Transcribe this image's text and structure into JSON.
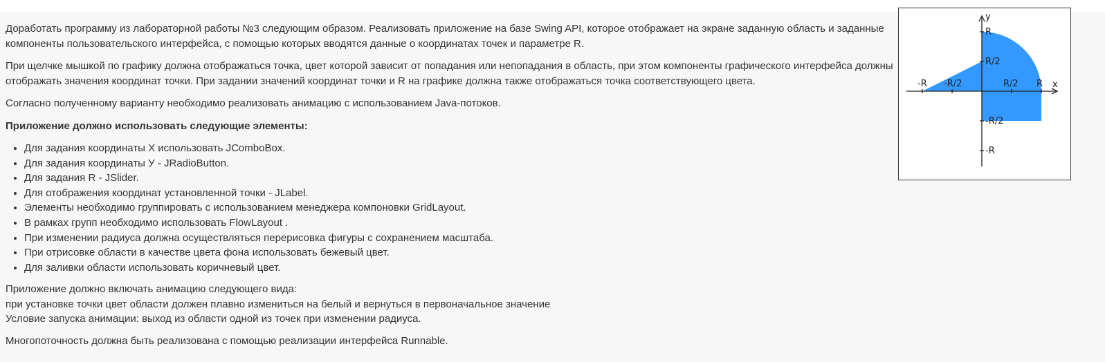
{
  "paragraphs": {
    "p1": "Доработать программу из лабораторной работы №3 следующим образом. Реализовать приложение на базе Swing API, которое отображает на экране заданную область и заданные компоненты пользовательского интерфейса, с помощью которых вводятся данные о координатах точек и параметре R.",
    "p2": "При щелчке мышкой по графику должна отображаться точка, цвет которой зависит от попадания или непопадания в область, при этом компоненты графического интерфейса должны отображать значения координат точки. При задании значений координат точки и R на графике должна также отображаться точка соответствующего цвета.",
    "p3": "Согласно полученному варианту необходимо реализовать анимацию с использованием Java-потоков.",
    "p4": "Приложение должно использовать следующие элементы:"
  },
  "elements_list": [
    "Для задания координаты Х использовать JComboBox.",
    "Для задания координаты У - JRadioButton.",
    "Для задания R - JSlider.",
    "Для отображения координат установленной точки - JLabel.",
    "Элементы необходимо группировать с использованием менеджера компоновки GridLayout.",
    "В рамках групп необходимо использовать FlowLayout .",
    "При изменении радиуса должна осуществляться перерисовка фигуры с сохранением масштаба.",
    "При отрисовке области в качестве цвета фона использовать бежевый цвет.",
    "Для заливки области использовать коричневый цвет."
  ],
  "animation": {
    "line1": "Приложение должно включать анимацию следующего вида:",
    "line2": "при установке точки цвет области должен плавно измениться на белый и вернуться в первоначальное значение",
    "line3": "Условие запуска анимации: выход из области одной из точек при изменении радиуса."
  },
  "final_paragraph": "Многопоточность должна быть реализована с помощью реализации интерфейса Runnable.",
  "figure": {
    "fill_color": "#3399ff",
    "axis_x_label": "x",
    "axis_y_label": "y",
    "x_labels": [
      "-R",
      "-R/2",
      "R/2",
      "R"
    ],
    "y_labels": [
      "R",
      "R/2",
      "-R/2",
      "-R"
    ]
  }
}
